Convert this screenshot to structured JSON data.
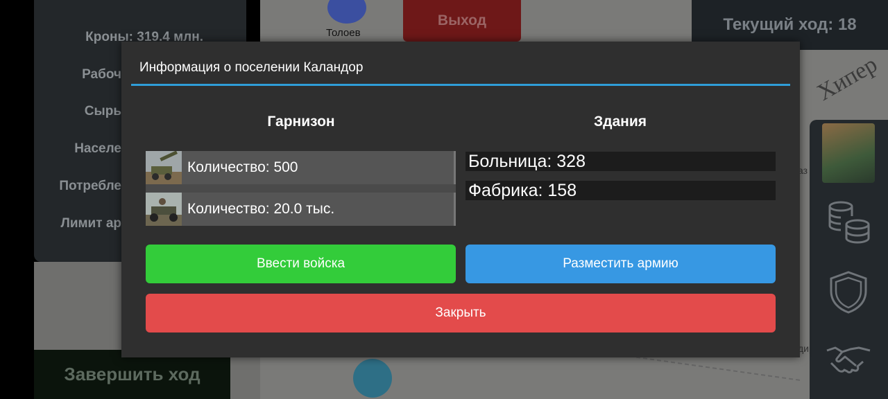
{
  "top_bar": {
    "exit_label": "Выход",
    "current_turn": "Текущий ход: 18"
  },
  "left_panel": {
    "stats": [
      "Кроны: 319.4 млн.",
      "Рабоч",
      "Сырь",
      "Населе",
      "Потребле",
      "Лимит ар"
    ],
    "end_turn_label": "Завершить ход"
  },
  "map": {
    "cities": [
      "Толоев"
    ],
    "region_label": "Хипер",
    "partial_labels": [
      "аз",
      "дир"
    ]
  },
  "right_sidebar": {
    "icons": [
      "avatar",
      "coins-icon",
      "shield-icon",
      "handshake-icon"
    ]
  },
  "dialog": {
    "title": "Информация о поселении Каландор",
    "garrison": {
      "title": "Гарнизон",
      "units": [
        {
          "icon": "artillery-unit-image",
          "text": "Количество: 500"
        },
        {
          "icon": "atv-unit-image",
          "text": "Количество: 20.0 тыс."
        }
      ]
    },
    "buildings": {
      "title": "Здания",
      "items": [
        "Больница: 328",
        "Фабрика: 158"
      ]
    },
    "buttons": {
      "deploy": "Ввести войска",
      "place_army": "Разместить армию",
      "close": "Закрыть"
    }
  },
  "colors": {
    "accent_line": "#2f9ed8",
    "deploy_button": "#33cc3a",
    "place_button": "#3798e3",
    "close_button": "#e34b4b",
    "dialog_bg": "#2f2f2f"
  }
}
